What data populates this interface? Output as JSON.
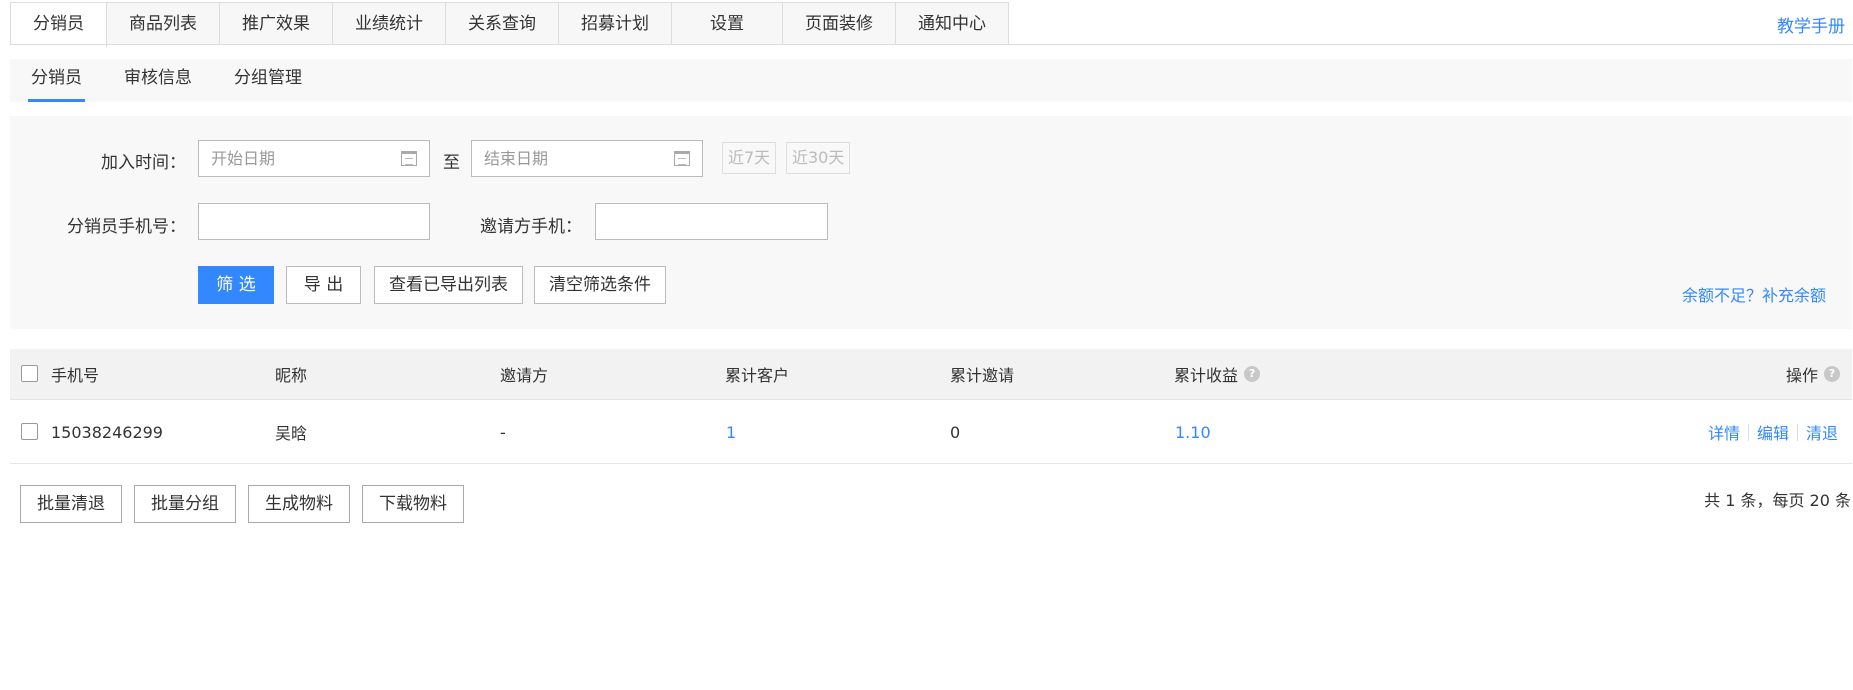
{
  "top_tabs": [
    "分销员",
    "商品列表",
    "推广效果",
    "业绩统计",
    "关系查询",
    "招募计划",
    "设置",
    "页面装修",
    "通知中心"
  ],
  "help_link": "教学手册",
  "sub_tabs": [
    "分销员",
    "审核信息",
    "分组管理"
  ],
  "filter": {
    "join_time_label": "加入时间：",
    "start_placeholder": "开始日期",
    "to_label": "至",
    "end_placeholder": "结束日期",
    "last7": "近7天",
    "last30": "近30天",
    "phone_label": "分销员手机号：",
    "inviter_phone_label": "邀请方手机：",
    "filter_btn": "筛 选",
    "export_btn": "导 出",
    "view_export_btn": "查看已导出列表",
    "clear_btn": "清空筛选条件",
    "recharge_link": "余额不足？补充余额"
  },
  "table": {
    "headers": {
      "phone": "手机号",
      "nickname": "昵称",
      "inviter": "邀请方",
      "customers": "累计客户",
      "invites": "累计邀请",
      "earnings": "累计收益",
      "ops": "操作"
    },
    "rows": [
      {
        "phone": "15038246299",
        "nickname": "吴晗",
        "inviter": "-",
        "customers": "1",
        "invites": "0",
        "earnings": "1.10",
        "ops": [
          "详情",
          "编辑",
          "清退"
        ]
      }
    ]
  },
  "footer": {
    "batch_remove": "批量清退",
    "batch_group": "批量分组",
    "gen_material": "生成物料",
    "download_material": "下载物料",
    "pager": "共 1 条，每页 20 条"
  },
  "colors": {
    "accent": "#3388ff",
    "panel_bg": "#f8f8f8",
    "border": "#dddddd"
  }
}
